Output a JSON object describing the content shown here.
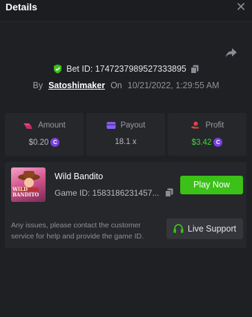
{
  "header": {
    "title": "Details",
    "close_icon": "close-icon"
  },
  "bet": {
    "id_label": "Bet ID: 1747237989527333895",
    "by_label": "By",
    "user": "Satoshimaker",
    "on_label": "On",
    "date": "10/21/2022, 1:29:55 AM"
  },
  "stats": {
    "amount": {
      "label": "Amount",
      "value": "$0.20"
    },
    "payout": {
      "label": "Payout",
      "value": "18.1 x"
    },
    "profit": {
      "label": "Profit",
      "value": "$3.42"
    }
  },
  "game": {
    "thumb_text": "WILD BANDITO",
    "name": "Wild Bandito",
    "id_label": "Game ID: 1583186231457...",
    "play_label": "Play Now",
    "notice": "Any issues, please contact the customer service for help and provide the game ID.",
    "support_label": "Live Support"
  },
  "colors": {
    "accent_green": "#3bc117",
    "profit_green": "#3ddc3b",
    "coin_purple": "#7b3fe4",
    "amount_pink": "#e8417a",
    "payout_purple": "#8a5cf6",
    "profit_red": "#e2443f"
  },
  "coin_symbol": "C"
}
